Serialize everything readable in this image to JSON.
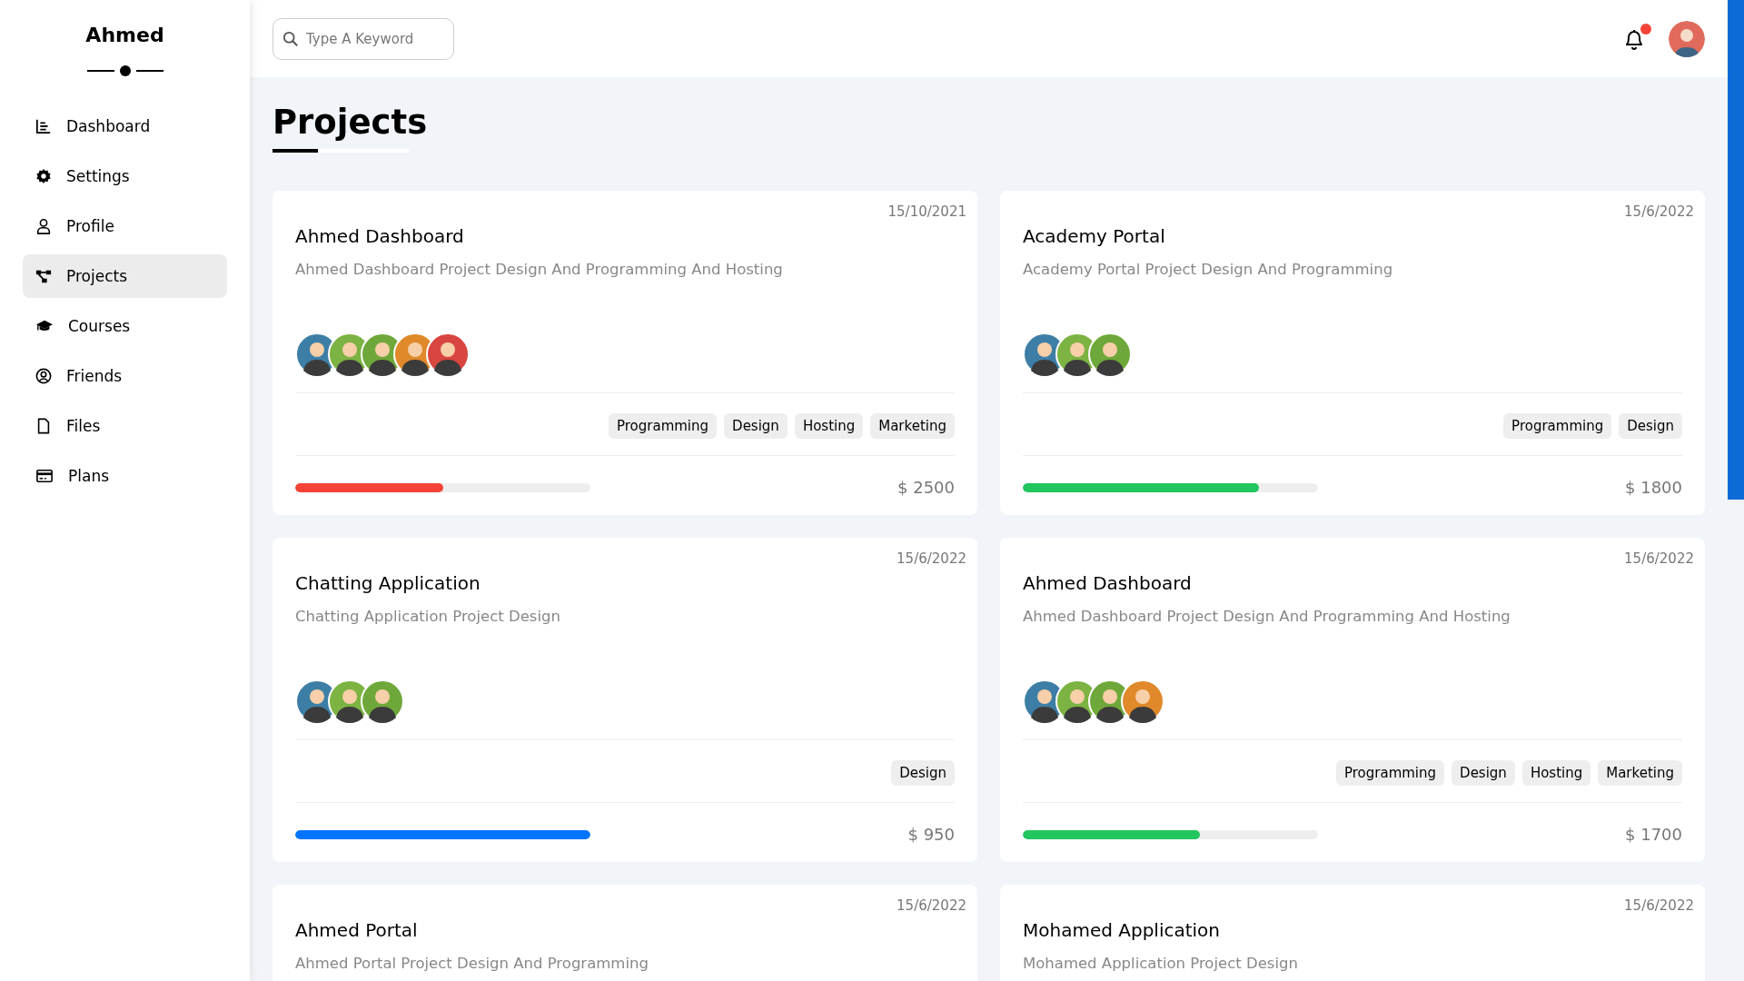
{
  "sidebar": {
    "title": "Ahmed",
    "items": [
      {
        "label": "Dashboard",
        "kind": "chart",
        "selected": false
      },
      {
        "label": "Settings",
        "kind": "gear",
        "selected": false
      },
      {
        "label": "Profile",
        "kind": "user",
        "selected": false
      },
      {
        "label": "Projects",
        "kind": "nodes",
        "selected": true
      },
      {
        "label": "Courses",
        "kind": "cap",
        "selected": false
      },
      {
        "label": "Friends",
        "kind": "circle-user",
        "selected": false
      },
      {
        "label": "Files",
        "kind": "file",
        "selected": false
      },
      {
        "label": "Plans",
        "kind": "card",
        "selected": false
      }
    ]
  },
  "search": {
    "placeholder": "Type A Keyword"
  },
  "header": {
    "has_notification": true,
    "avatar": {
      "color": "#e06b5c"
    }
  },
  "page_title": "Projects",
  "projects": [
    {
      "title": "Ahmed Dashboard",
      "description": "Ahmed Dashboard Project Design And Programming And Hosting",
      "date": "15/10/2021",
      "members": [
        {
          "color": "#3d7ea6"
        },
        {
          "color": "#7cb342"
        },
        {
          "color": "#6fa83a"
        },
        {
          "color": "#e0892a"
        },
        {
          "color": "#d9453f"
        }
      ],
      "tags": [
        "Programming",
        "Design",
        "Hosting",
        "Marketing"
      ],
      "progress": {
        "level": 0.5,
        "color": "#f44336"
      },
      "price": "$ 2500"
    },
    {
      "title": "Academy Portal",
      "description": "Academy Portal Project Design And Programming",
      "date": "15/6/2022",
      "members": [
        {
          "color": "#3d7ea6"
        },
        {
          "color": "#7cb342"
        },
        {
          "color": "#6fa83a"
        }
      ],
      "tags": [
        "Programming",
        "Design"
      ],
      "progress": {
        "level": 0.8,
        "color": "#22c55e"
      },
      "price": "$ 1800"
    },
    {
      "title": "Chatting Application",
      "description": "Chatting Application Project Design",
      "date": "15/6/2022",
      "members": [
        {
          "color": "#3d7ea6"
        },
        {
          "color": "#7cb342"
        },
        {
          "color": "#6fa83a"
        }
      ],
      "tags": [
        "Design"
      ],
      "progress": {
        "level": 1,
        "color": "#0075ff"
      },
      "price": "$ 950"
    },
    {
      "title": "Ahmed Dashboard",
      "description": "Ahmed Dashboard Project Design And Programming And Hosting",
      "date": "15/6/2022",
      "members": [
        {
          "color": "#3d7ea6"
        },
        {
          "color": "#7cb342"
        },
        {
          "color": "#6fa83a"
        },
        {
          "color": "#e0892a"
        }
      ],
      "tags": [
        "Programming",
        "Design",
        "Hosting",
        "Marketing"
      ],
      "progress": {
        "level": 0.6,
        "color": "#22c55e"
      },
      "price": "$ 1700"
    },
    {
      "title": "Ahmed Portal",
      "description": "Ahmed Portal Project Design And Programming",
      "date": "15/6/2022"
    },
    {
      "title": "Mohamed Application",
      "description": "Mohamed Application Project Design",
      "date": "15/6/2022"
    }
  ]
}
